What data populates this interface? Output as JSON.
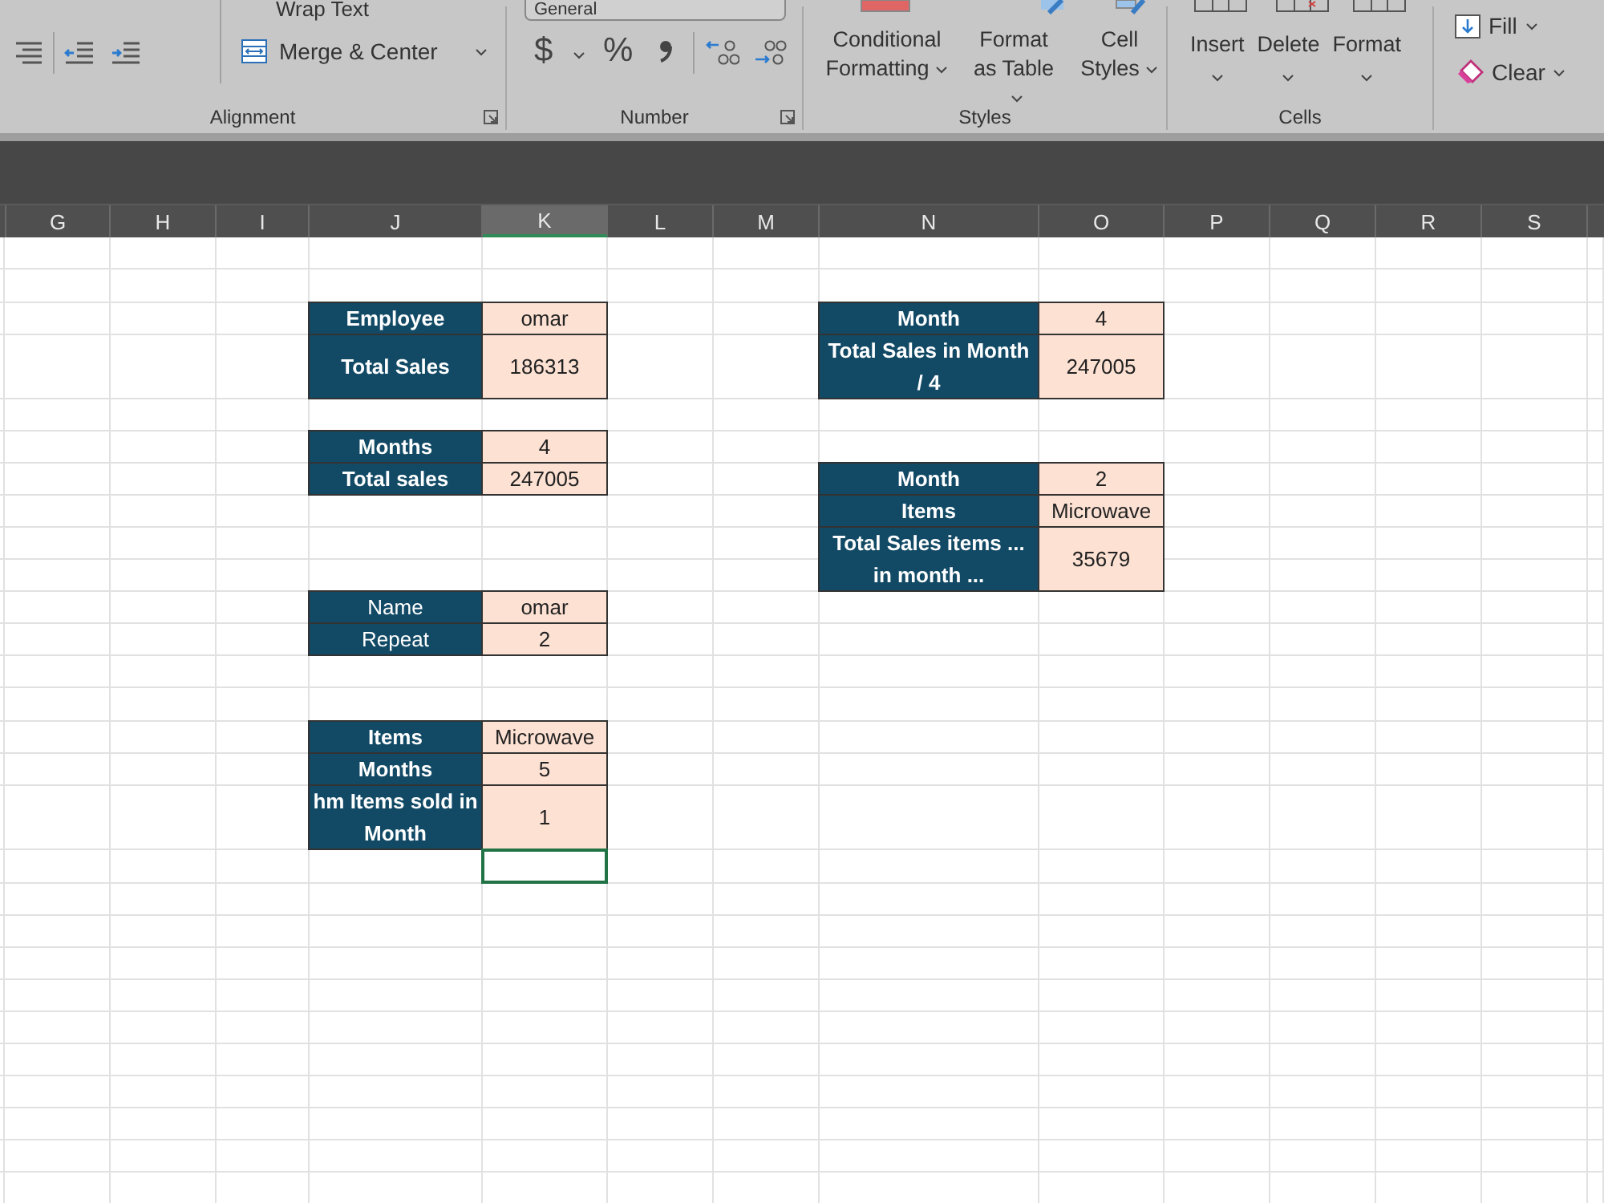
{
  "ribbon": {
    "alignment": {
      "label": "Alignment",
      "wrap_text": "Wrap Text",
      "merge": "Merge & Center"
    },
    "number": {
      "label": "Number",
      "format": "General",
      "currency": "$",
      "percent": "%"
    },
    "styles": {
      "label": "Styles",
      "buttons": [
        {
          "label": "Conditional Formatting"
        },
        {
          "label": "Format as Table"
        },
        {
          "label": "Cell Styles"
        }
      ]
    },
    "cells": {
      "label": "Cells",
      "buttons": [
        {
          "label": "Insert"
        },
        {
          "label": "Delete"
        },
        {
          "label": "Format"
        }
      ]
    },
    "editing": {
      "fill": "Fill",
      "clear": "Clear"
    }
  },
  "columns": [
    {
      "label": "G",
      "selected": false
    },
    {
      "label": "H",
      "selected": false
    },
    {
      "label": "I",
      "selected": false
    },
    {
      "label": "J",
      "selected": false
    },
    {
      "label": "K",
      "selected": true
    },
    {
      "label": "L",
      "selected": false
    },
    {
      "label": "M",
      "selected": false
    },
    {
      "label": "N",
      "selected": false
    },
    {
      "label": "O",
      "selected": false
    },
    {
      "label": "P",
      "selected": false
    },
    {
      "label": "Q",
      "selected": false
    },
    {
      "label": "R",
      "selected": false
    },
    {
      "label": "S",
      "selected": false
    }
  ],
  "tables": [
    {
      "label_bold": true,
      "rows": [
        {
          "label": "Employee",
          "value": "omar"
        },
        {
          "label": "Total Sales",
          "value": "186313"
        }
      ]
    },
    {
      "label_bold": true,
      "rows": [
        {
          "label": "Month",
          "value": "4"
        },
        {
          "label": "Total Sales in Month / 4",
          "value": "247005"
        }
      ]
    },
    {
      "label_bold": true,
      "rows": [
        {
          "label": "Months",
          "value": "4"
        },
        {
          "label": "Total sales",
          "value": "247005"
        }
      ]
    },
    {
      "label_bold": true,
      "rows": [
        {
          "label": "Month",
          "value": "2"
        },
        {
          "label": "Items",
          "value": "Microwave"
        },
        {
          "label": "Total Sales items ... in month ...",
          "value": "35679"
        }
      ]
    },
    {
      "label_bold": false,
      "rows": [
        {
          "label": "Name",
          "value": "omar"
        },
        {
          "label": "Repeat",
          "value": "2"
        }
      ]
    },
    {
      "label_bold": true,
      "rows": [
        {
          "label": "Items",
          "value": "Microwave"
        },
        {
          "label": "Months",
          "value": "5"
        },
        {
          "label": "hm Items sold in Month",
          "value": "1"
        }
      ]
    }
  ]
}
